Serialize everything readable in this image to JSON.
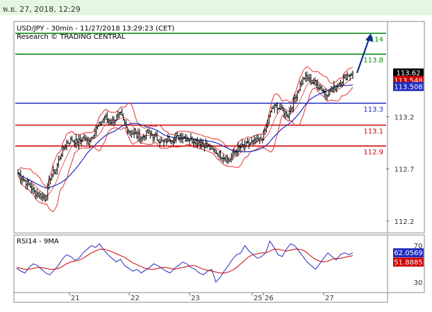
{
  "header": {
    "date_time": "พ.ย. 27, 2018, 12:29"
  },
  "chart_data": [
    {
      "type": "candlestick",
      "title": "USD/JPY - 30min - 11/27/2018 13:29:23 (CET)",
      "subtitle": "Research © TRADING CENTRAL",
      "ylim": [
        112.1,
        114.1
      ],
      "y_ticks": [
        "113.2",
        "112.7",
        "112.2"
      ],
      "x_ticks": [
        "21",
        "22",
        "23",
        "25",
        "26",
        "27"
      ],
      "levels": [
        {
          "label": "114",
          "value": 114.0,
          "color": "#0f8a0f"
        },
        {
          "label": "113.8",
          "value": 113.8,
          "color": "#0f8a0f"
        },
        {
          "label": "113.3",
          "value": 113.33,
          "color": "#1f2bbf"
        },
        {
          "label": "113.1",
          "value": 113.12,
          "color": "#cc0000"
        },
        {
          "label": "112.9",
          "value": 112.92,
          "color": "#cc0000"
        }
      ],
      "price_tags": [
        {
          "label": "113.62",
          "value": 113.62,
          "bg": "#000000"
        },
        {
          "label": "113.548",
          "value": 113.55,
          "bg": "#cc0000"
        },
        {
          "label": "113.508",
          "value": 113.49,
          "bg": "#1f2bbf"
        }
      ],
      "forecast_arrow": {
        "from_value": 113.62,
        "to_value": 114.0
      },
      "close_path": [
        112.66,
        112.6,
        112.55,
        112.48,
        112.45,
        112.42,
        112.62,
        112.7,
        112.85,
        112.95,
        112.98,
        112.95,
        113.0,
        112.96,
        113.05,
        113.12,
        113.2,
        113.15,
        113.18,
        113.22,
        113.1,
        113.05,
        113.02,
        113.0,
        113.05,
        113.02,
        112.98,
        112.95,
        113.0,
        112.98,
        113.02,
        113.0,
        112.98,
        112.97,
        112.95,
        112.92,
        112.88,
        112.85,
        112.82,
        112.78,
        112.86,
        112.9,
        112.92,
        112.95,
        112.96,
        112.98,
        113.1,
        113.28,
        113.3,
        113.25,
        113.22,
        113.35,
        113.48,
        113.58,
        113.55,
        113.52,
        113.48,
        113.42,
        113.45,
        113.5,
        113.55,
        113.6,
        113.62
      ]
    },
    {
      "type": "line",
      "title": "RSI14 - 9MA",
      "ylim": [
        20,
        80
      ],
      "y_ticks": [
        "70",
        "50",
        "30"
      ],
      "tags": [
        {
          "label": "62.0569",
          "value": 62.06,
          "bg": "#1f2bbf"
        },
        {
          "label": "51.8885",
          "value": 51.89,
          "bg": "#cc0000"
        }
      ],
      "series": [
        {
          "values": [
            45,
            42,
            40,
            46,
            50,
            48,
            44,
            40,
            38,
            43,
            48,
            55,
            60,
            58,
            54,
            56,
            62,
            66,
            70,
            68,
            72,
            65,
            60,
            56,
            52,
            55,
            48,
            45,
            42,
            44,
            40,
            43,
            46,
            50,
            48,
            45,
            42,
            40,
            45,
            48,
            52,
            50,
            46,
            44,
            40,
            38,
            42,
            44,
            30,
            35,
            42,
            48,
            55,
            60,
            62,
            70,
            64,
            60,
            56,
            58,
            62,
            75,
            68,
            60,
            58,
            66,
            72,
            70,
            64,
            58,
            52,
            48,
            44,
            50,
            56,
            62,
            58,
            54,
            60,
            62,
            60,
            62
          ]
        },
        {
          "values": [
            46,
            45,
            44,
            44,
            45,
            46,
            46,
            45,
            44,
            44,
            45,
            47,
            50,
            52,
            53,
            54,
            56,
            59,
            62,
            64,
            66,
            66,
            65,
            63,
            61,
            59,
            57,
            54,
            51,
            49,
            47,
            45,
            44,
            44,
            45,
            46,
            46,
            45,
            44,
            45,
            46,
            47,
            48,
            48,
            46,
            44,
            43,
            42,
            41,
            40,
            40,
            41,
            43,
            46,
            50,
            54,
            58,
            60,
            61,
            62,
            62,
            64,
            66,
            66,
            65,
            64,
            65,
            66,
            66,
            65,
            62,
            58,
            55,
            53,
            52,
            53,
            55,
            56,
            56,
            57,
            58,
            59
          ]
        }
      ]
    }
  ],
  "style": {
    "up_color": "#000000",
    "down_color": "#000000",
    "bb_color": "#e03030",
    "ma_color": "#1f2bbf",
    "rsi_color": "#1f2bbf",
    "rsi_ma_color": "#cc0000"
  }
}
